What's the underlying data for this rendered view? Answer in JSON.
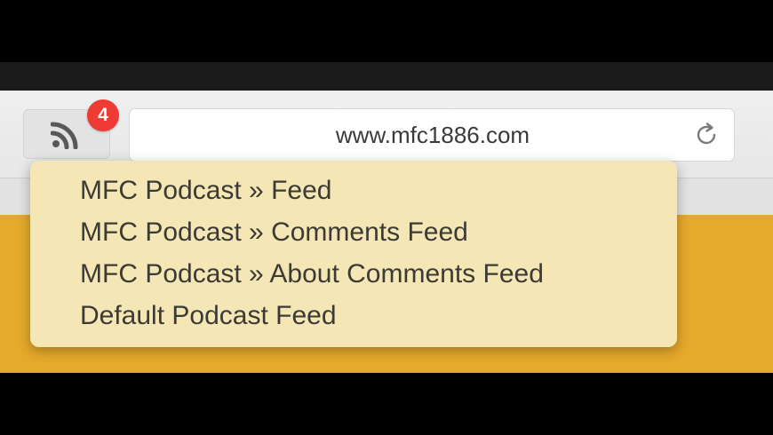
{
  "toolbar": {
    "feed_badge_count": "4",
    "address": {
      "url": "www.mfc1886.com"
    },
    "icons": {
      "feed": "rss-icon",
      "reload": "reload-icon"
    }
  },
  "feed_menu": {
    "items": [
      {
        "label": "MFC Podcast » Feed"
      },
      {
        "label": "MFC Podcast » Comments Feed"
      },
      {
        "label": "MFC Podcast » About Comments Feed"
      },
      {
        "label": "Default Podcast Feed"
      }
    ]
  },
  "colors": {
    "badge": "#ee3b33",
    "menu_background": "#f4e7b5",
    "page_accent": "#e5a92b"
  }
}
